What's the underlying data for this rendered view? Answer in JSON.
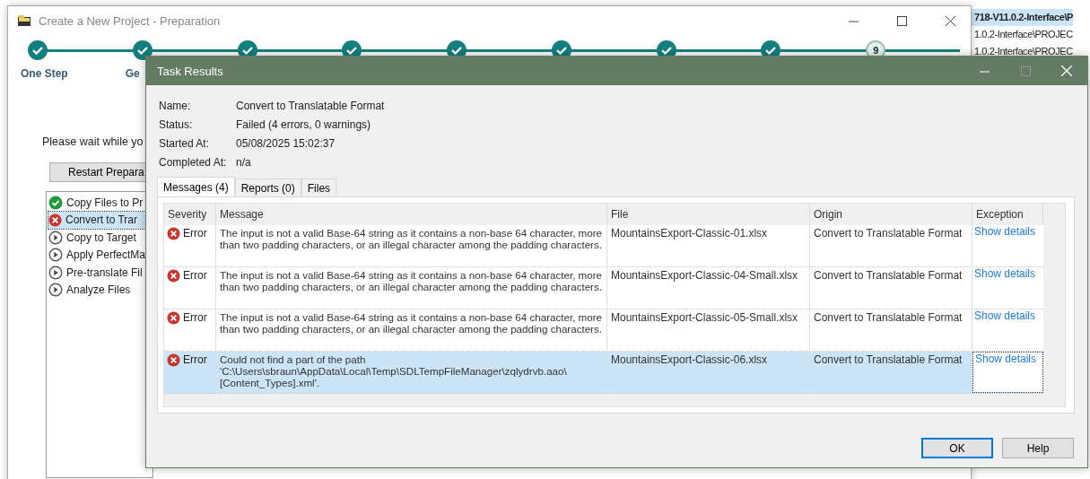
{
  "background_list": {
    "rows": [
      {
        "text": "718-V11.0.2-Interface\\P",
        "selected": true
      },
      {
        "text": "1.0.2-Interface\\PROJEC",
        "selected": false
      },
      {
        "text": "1.0.2-Interface\\PROJEC",
        "selected": false
      }
    ]
  },
  "project_window": {
    "title": "Create a New Project - Preparation",
    "steps": [
      {
        "label": "One Step",
        "kind": "done"
      },
      {
        "label": "Ge",
        "kind": "done"
      },
      {
        "kind": "done"
      },
      {
        "kind": "done"
      },
      {
        "kind": "done"
      },
      {
        "kind": "done"
      },
      {
        "kind": "done"
      },
      {
        "kind": "done"
      },
      {
        "number": "9",
        "kind": "current"
      }
    ],
    "message": "Please wait while yo",
    "restart_button": "Restart Prepara",
    "tasks": [
      {
        "label": "Copy Files to Pr",
        "kind": "done",
        "selected": false
      },
      {
        "label": "Convert to Trar",
        "kind": "error",
        "selected": true
      },
      {
        "label": "Copy to Target",
        "kind": "pending",
        "selected": false
      },
      {
        "label": "Apply PerfectMa",
        "kind": "pending",
        "selected": false
      },
      {
        "label": "Pre-translate Fil",
        "kind": "pending",
        "selected": false
      },
      {
        "label": "Analyze Files",
        "kind": "pending",
        "selected": false
      }
    ]
  },
  "dialog": {
    "title": "Task Results",
    "maximize_disabled": true,
    "fields": [
      {
        "label": "Name:",
        "value": "Convert to Translatable Format"
      },
      {
        "label": "Status:",
        "value": "Failed (4 errors, 0 warnings)"
      },
      {
        "label": "Started At:",
        "value": "05/08/2025 15:02:37"
      },
      {
        "label": "Completed At:",
        "value": "n/a"
      }
    ],
    "tabs": [
      {
        "label": "Messages (4)",
        "selected": true
      },
      {
        "label": "Reports (0)",
        "selected": false
      },
      {
        "label": "Files",
        "selected": false
      }
    ],
    "table": {
      "columns": [
        "Severity",
        "Message",
        "File",
        "Origin",
        "Exception"
      ],
      "rows": [
        {
          "severity": "Error",
          "message": "The input is not a valid Base-64 string as it contains a non-base 64 character, more than two padding characters, or an illegal character among the padding characters.",
          "file": "MountainsExport-Classic-01.xlsx",
          "origin": "Convert to Translatable Format",
          "exception": "Show details",
          "selected": false
        },
        {
          "severity": "Error",
          "message": "The input is not a valid Base-64 string as it contains a non-base 64 character, more than two padding characters, or an illegal character among the padding characters.",
          "file": "MountainsExport-Classic-04-Small.xlsx",
          "origin": "Convert to Translatable Format",
          "exception": "Show details",
          "selected": false
        },
        {
          "severity": "Error",
          "message": "The input is not a valid Base-64 string as it contains a non-base 64 character, more than two padding characters, or an illegal character among the padding characters.",
          "file": "MountainsExport-Classic-05-Small.xlsx",
          "origin": "Convert to Translatable Format",
          "exception": "Show details",
          "selected": false
        },
        {
          "severity": "Error",
          "message": "Could not find a part of the path 'C:\\Users\\sbraun\\AppData\\Local\\Temp\\SDLTempFileManager\\zqlydrvb.aao\\[Content_Types].xml'.",
          "file": "MountainsExport-Classic-06.xlsx",
          "origin": "Convert to Translatable Format",
          "exception": "Show details",
          "selected": true
        }
      ]
    },
    "buttons": [
      {
        "label": "OK",
        "default": true
      },
      {
        "label": "Help",
        "default": false
      }
    ]
  }
}
